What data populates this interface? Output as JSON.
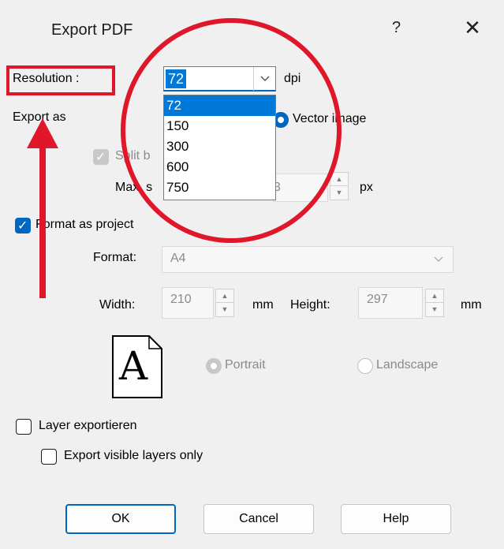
{
  "dialog": {
    "title": "Export PDF",
    "help_glyph": "?",
    "close_glyph": "✕"
  },
  "resolution": {
    "label": "Resolution :",
    "value": "72",
    "unit": "dpi",
    "options": [
      "72",
      "150",
      "300",
      "600",
      "750"
    ],
    "selected": "72"
  },
  "export_as": {
    "label": "Export as",
    "vector_option": "Vector image"
  },
  "split": {
    "label": "Split b",
    "max_label": "Max. s",
    "max_value_partial": "3",
    "unit": "px"
  },
  "format_as_project": {
    "label": "Format as project",
    "checked": true
  },
  "format": {
    "label": "Format:",
    "value": "A4"
  },
  "size": {
    "width_label": "Width:",
    "width_value": "210",
    "width_unit": "mm",
    "height_label": "Height:",
    "height_value": "297",
    "height_unit": "mm"
  },
  "orientation": {
    "page_glyph": "A",
    "portrait": "Portrait",
    "landscape": "Landscape",
    "selected": "Portrait"
  },
  "layers": {
    "export_label": "Layer exportieren",
    "visible_only_label": "Export visible layers only"
  },
  "buttons": {
    "ok": "OK",
    "cancel": "Cancel",
    "help": "Help"
  },
  "annotation_colors": {
    "highlight": "#e0162b",
    "accent": "#0067c0"
  },
  "icons": [
    "chevron-down-icon",
    "check-icon",
    "arrow-up-icon",
    "page-icon",
    "close-icon"
  ]
}
